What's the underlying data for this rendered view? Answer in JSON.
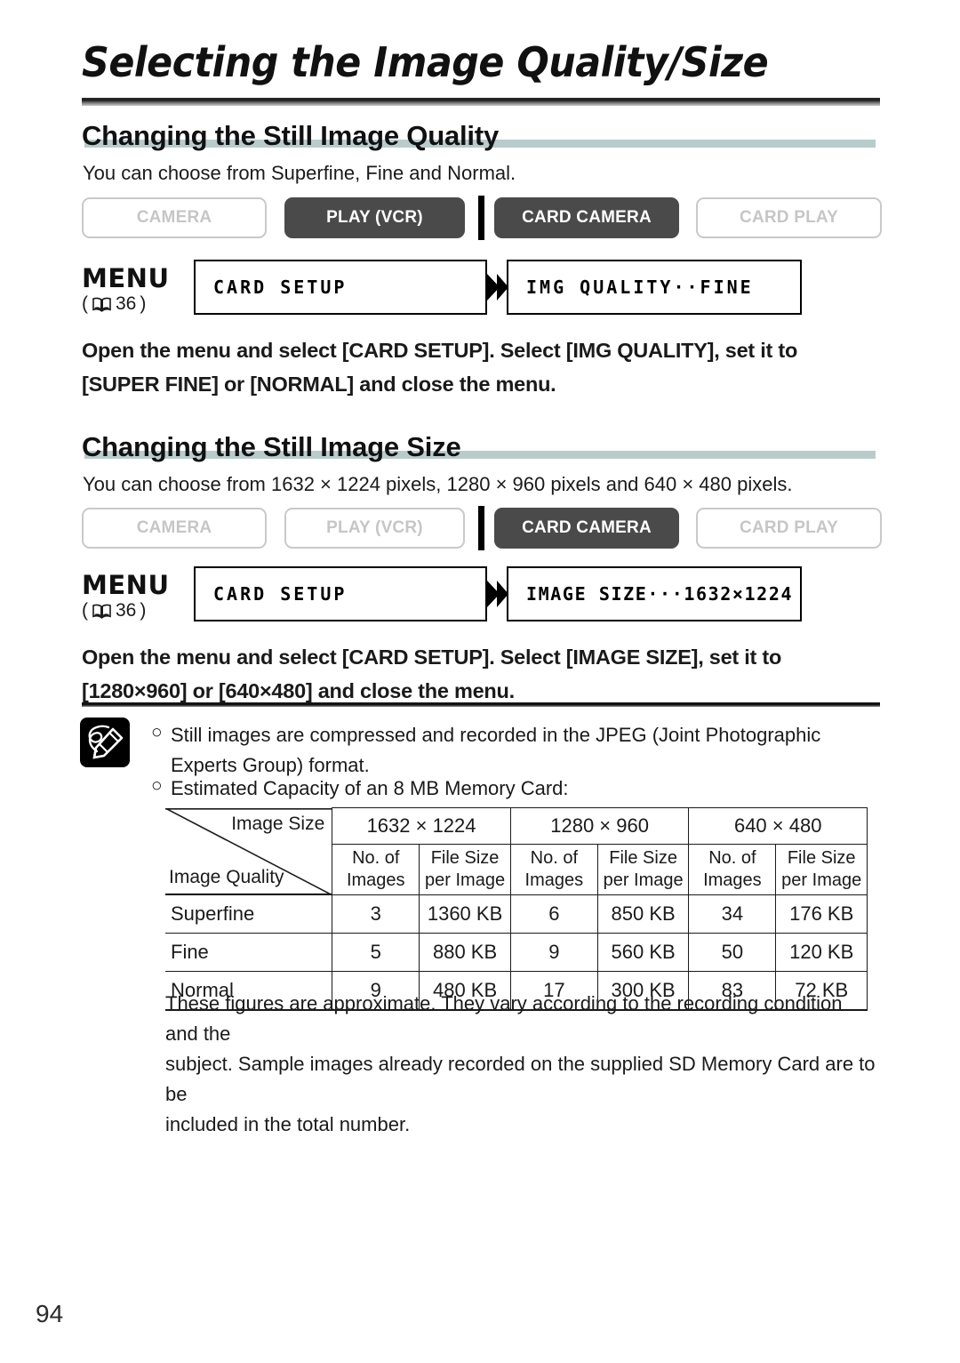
{
  "page": {
    "title": "Selecting the Image Quality/Size",
    "number": "94"
  },
  "sections": [
    {
      "heading": "Changing the Still Image Quality",
      "intro": "You can choose from Superfine, Fine and Normal.",
      "modes": [
        {
          "label": "CAMERA",
          "active": false
        },
        {
          "label": "PLAY (VCR)",
          "active": true
        },
        {
          "label": "CARD CAMERA",
          "active": true
        },
        {
          "label": "CARD PLAY",
          "active": false
        }
      ],
      "menu": {
        "label": "MENU",
        "ref_open": "(",
        "ref_page": "36",
        "ref_close": ")",
        "box1": "CARD SETUP",
        "box2": "IMG QUALITY··FINE",
        "arrow_icon": "double-chevron-right-icon",
        "book_icon": "open-book-icon"
      },
      "instruction_line1": "Open the menu and select [CARD SETUP]. Select [IMG QUALITY], set it to",
      "instruction_line2": "[SUPER FINE] or [NORMAL] and close the menu."
    },
    {
      "heading": "Changing the Still Image Size",
      "intro": "You can choose from 1632 × 1224 pixels, 1280 × 960 pixels and 640 × 480 pixels.",
      "modes": [
        {
          "label": "CAMERA",
          "active": false
        },
        {
          "label": "PLAY (VCR)",
          "active": false
        },
        {
          "label": "CARD CAMERA",
          "active": true
        },
        {
          "label": "CARD PLAY",
          "active": false
        }
      ],
      "menu": {
        "label": "MENU",
        "ref_open": "(",
        "ref_page": "36",
        "ref_close": ")",
        "box1": "CARD SETUP",
        "box2": "IMAGE SIZE···1632×1224",
        "arrow_icon": "double-chevron-right-icon",
        "book_icon": "open-book-icon"
      },
      "instruction_line1": "Open the menu and select [CARD SETUP]. Select [IMAGE SIZE], set it to",
      "instruction_line2": "[1280×960] or [640×480] and close the menu."
    }
  ],
  "notes": {
    "icon": "memo-pencil-icon",
    "bullet": "○",
    "items": [
      {
        "line1": "Still images are compressed and recorded in the JPEG (Joint Photographic",
        "line2": "Experts Group) format."
      },
      {
        "line1": "Estimated Capacity of an 8 MB Memory Card:",
        "line2": ""
      }
    ]
  },
  "table": {
    "corner_top_label": "Image Size",
    "corner_bottom_label": "Image Quality",
    "size_headers": [
      "1632 × 1224",
      "1280 × 960",
      "640 × 480"
    ],
    "sub_headers": [
      "No. of Images",
      "File Size per Image"
    ],
    "sub_header_lines": [
      [
        "No. of",
        "Images"
      ],
      [
        "File Size",
        "per Image"
      ]
    ],
    "rows": [
      {
        "quality": "Superfine",
        "cells": [
          "3",
          "1360 KB",
          "6",
          "850 KB",
          "34",
          "176 KB"
        ]
      },
      {
        "quality": "Fine",
        "cells": [
          "5",
          "880 KB",
          "9",
          "560 KB",
          "50",
          "120 KB"
        ]
      },
      {
        "quality": "Normal",
        "cells": [
          "9",
          "480 KB",
          "17",
          "300 KB",
          "83",
          "72 KB"
        ]
      }
    ]
  },
  "footnote": {
    "line1": "These figures are approximate. They vary according to the recording condition and the",
    "line2": "subject. Sample images already recorded on the supplied SD Memory Card are to be",
    "line3": "included in the total number."
  },
  "colors": {
    "active_button": "#4a4a4a",
    "inactive_button_border": "#c9c9c9",
    "inactive_button_text": "#c6c6c6",
    "heading_underline": "#b9cccb",
    "rule": "#141414"
  }
}
